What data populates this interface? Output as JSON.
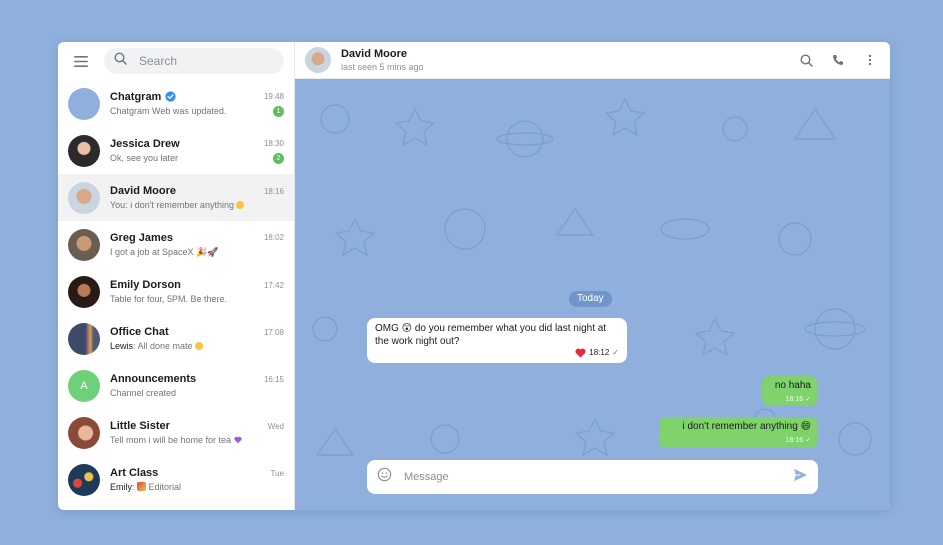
{
  "sidebar": {
    "search": {
      "placeholder": "Search"
    },
    "chats": [
      {
        "name": "Chatgram",
        "verified": true,
        "time": "19:48",
        "message": "Chatgram Web was updated.",
        "unread": "1",
        "avatar_color": "#8fb0dd"
      },
      {
        "name": "Jessica Drew",
        "time": "18:30",
        "message": "Ok, see you later",
        "unread": "2",
        "avatar_color": "#2b2b2b"
      },
      {
        "name": "David Moore",
        "time": "18:16",
        "message": "You: i don't remember anything",
        "active": true,
        "avatar_color": "#c9d6e2"
      },
      {
        "name": "Greg James",
        "time": "18:02",
        "message": "I got a job at SpaceX",
        "avatar_color": "#7a6b5a"
      },
      {
        "name": "Emily Dorson",
        "time": "17:42",
        "message": "Table for four, 5PM. Be there.",
        "avatar_color": "#3a2a25"
      },
      {
        "name": "Office Chat",
        "time": "17:08",
        "sender": "Lewis",
        "message": "All done mate",
        "avatar_color": "#4a5a7a"
      },
      {
        "name": "Announcements",
        "time": "16:15",
        "message": "Channel created",
        "avatar_letter": "A",
        "avatar_color": "#6fd07a"
      },
      {
        "name": "Little Sister",
        "time": "Wed",
        "message": "Tell mom i will be home for tea",
        "avatar_color": "#c88a6a"
      },
      {
        "name": "Art Class",
        "time": "Tue",
        "sender": "Emily",
        "message": "Editorial",
        "avatar_color": "#1e3a5a"
      }
    ]
  },
  "header": {
    "name": "David Moore",
    "status": "last seen 5 mins ago"
  },
  "conversation": {
    "date_label": "Today",
    "messages": [
      {
        "direction": "in",
        "text": "OMG 😲 do you remember what you did last night at the work night out?",
        "time": "18:12",
        "reaction": "heart"
      },
      {
        "direction": "out",
        "text": "no haha",
        "time": "18:16"
      },
      {
        "direction": "out",
        "text": "i don't remember anything 😄",
        "time": "18:16"
      }
    ]
  },
  "composer": {
    "placeholder": "Message"
  },
  "colors": {
    "accent": "#3390ec",
    "bubble_out": "#7fd26c",
    "background": "#8fb0dd",
    "badge": "#5fbf5f"
  }
}
